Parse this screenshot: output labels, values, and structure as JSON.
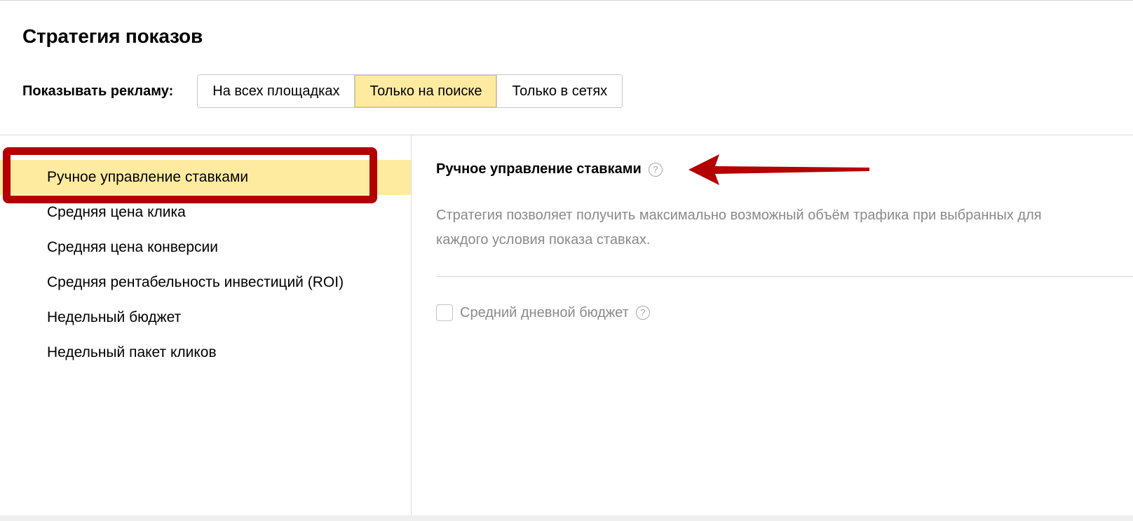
{
  "page": {
    "title": "Стратегия показов"
  },
  "show_ads": {
    "label": "Показывать рекламу:",
    "options": [
      {
        "label": "На всех площадках",
        "active": false
      },
      {
        "label": "Только на поиске",
        "active": true
      },
      {
        "label": "Только в сетях",
        "active": false
      }
    ]
  },
  "strategies": {
    "items": [
      {
        "label": "Ручное управление ставками",
        "selected": true
      },
      {
        "label": "Средняя цена клика",
        "selected": false
      },
      {
        "label": "Средняя цена конверсии",
        "selected": false
      },
      {
        "label": "Средняя рентабельность инвестиций (ROI)",
        "selected": false
      },
      {
        "label": "Недельный бюджет",
        "selected": false
      },
      {
        "label": "Недельный пакет кликов",
        "selected": false
      }
    ]
  },
  "detail": {
    "title": "Ручное управление ставками",
    "help_glyph": "?",
    "description_line1": "Стратегия позволяет получить максимально возможный объём трафика при выбранных для",
    "description_line2": "каждого условия показа ставках.",
    "budget": {
      "label": "Средний дневной бюджет",
      "checked": false,
      "help_glyph": "?"
    }
  },
  "annotations": {
    "highlight_color": "#b30000",
    "arrow_color": "#b30000"
  },
  "colors": {
    "active_bg": "#ffeba0",
    "muted_text": "#8a8a8a",
    "divider": "#dcdcdc"
  },
  "icons": {
    "help": "question-circle-icon",
    "arrow": "left-arrow-annotation",
    "checkbox": "checkbox-unchecked"
  }
}
